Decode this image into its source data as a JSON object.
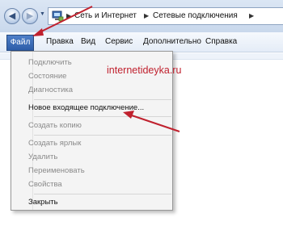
{
  "address_bar": {
    "breadcrumbs": [
      "Сеть и Интернет",
      "Сетевые подключения"
    ]
  },
  "menubar": {
    "items": [
      "Файл",
      "Правка",
      "Вид",
      "Сервис",
      "Дополнительно",
      "Справка"
    ]
  },
  "file_menu": {
    "items": [
      {
        "label": "Подключить",
        "enabled": false
      },
      {
        "label": "Состояние",
        "enabled": false
      },
      {
        "label": "Диагностика",
        "enabled": false
      },
      {
        "label": "Новое входящее подключение...",
        "enabled": true
      },
      {
        "label": "Создать копию",
        "enabled": false
      },
      {
        "label": "Создать ярлык",
        "enabled": false
      },
      {
        "label": "Удалить",
        "enabled": false
      },
      {
        "label": "Переименовать",
        "enabled": false
      },
      {
        "label": "Свойства",
        "enabled": false
      },
      {
        "label": "Закрыть",
        "enabled": true
      }
    ]
  },
  "watermark": "internetideyka.ru",
  "colors": {
    "annotation_arrow": "#c0212e",
    "menu_highlight": "#2d5ea9"
  }
}
